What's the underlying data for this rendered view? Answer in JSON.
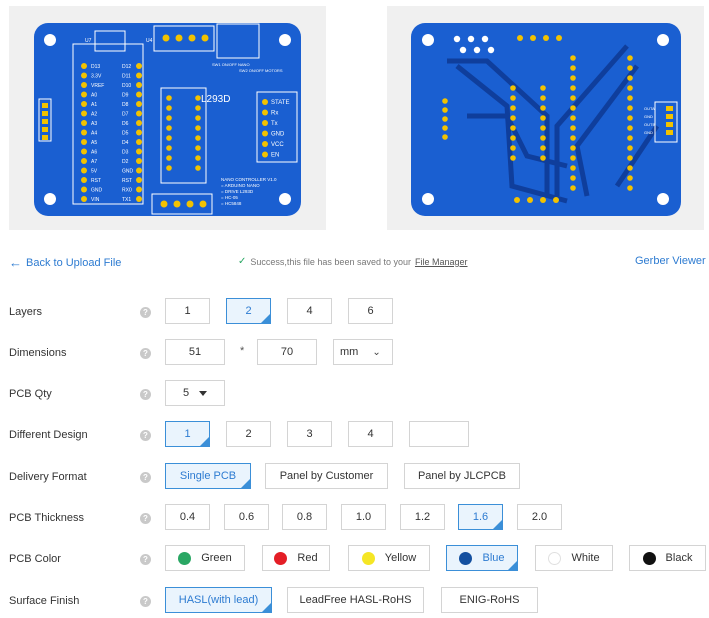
{
  "preview": {
    "front": {
      "module_labels": [
        "U7",
        "U4"
      ],
      "header_pins_left": [
        "D13",
        "3.3V",
        "VREF",
        "A0",
        "A1",
        "A2",
        "A3",
        "A4",
        "A5",
        "A6",
        "A7",
        "5V",
        "RST",
        "GND",
        "VIN"
      ],
      "header_pins_right": [
        "D12",
        "D11",
        "D10",
        "D9",
        "D8",
        "D7",
        "D6",
        "D5",
        "D4",
        "D3",
        "D2",
        "GND",
        "RST",
        "RX0",
        "TX1"
      ],
      "ic_label": "L293D",
      "bt_pins": [
        "STATE",
        "Rx",
        "Tx",
        "GND",
        "VCC",
        "EN"
      ],
      "switch_labels": [
        "SW1 ON/OFF NANO",
        "SW2 ON/OFF MOTORS"
      ],
      "info_lines": [
        "NANO CONTROLLER V1.0",
        "= ARDUINO NANO",
        "= DRIVE L293D",
        "= HC-05",
        "= HC5848"
      ]
    },
    "back": {
      "side_labels": [
        "OUTA",
        "GND",
        "OUTB",
        "GND"
      ]
    }
  },
  "nav": {
    "back_label": "Back to Upload File",
    "success_text": "Success,this file has been saved to your",
    "file_manager_label": "File Manager",
    "gerber_label": "Gerber Viewer"
  },
  "form": {
    "layers": {
      "label": "Layers",
      "options": [
        "1",
        "2",
        "4",
        "6"
      ],
      "selected": "2"
    },
    "dimensions": {
      "label": "Dimensions",
      "width": "51",
      "height": "70",
      "separator": "*",
      "unit": "mm"
    },
    "qty": {
      "label": "PCB Qty",
      "value": "5"
    },
    "different_design": {
      "label": "Different Design",
      "options": [
        "1",
        "2",
        "3",
        "4"
      ],
      "selected": "1",
      "custom": ""
    },
    "delivery": {
      "label": "Delivery Format",
      "options": [
        "Single PCB",
        "Panel by Customer",
        "Panel by JLCPCB"
      ],
      "selected": "Single PCB"
    },
    "thickness": {
      "label": "PCB Thickness",
      "options": [
        "0.4",
        "0.6",
        "0.8",
        "1.0",
        "1.2",
        "1.6",
        "2.0"
      ],
      "selected": "1.6"
    },
    "color": {
      "label": "PCB Color",
      "options": [
        {
          "name": "Green",
          "hex": "#2aa764"
        },
        {
          "name": "Red",
          "hex": "#e41e26"
        },
        {
          "name": "Yellow",
          "hex": "#f5e625"
        },
        {
          "name": "Blue",
          "hex": "#1450a0"
        },
        {
          "name": "White",
          "hex": "#ffffff"
        },
        {
          "name": "Black",
          "hex": "#111111"
        }
      ],
      "selected": "Blue"
    },
    "finish": {
      "label": "Surface Finish",
      "options": [
        "HASL(with lead)",
        "LeadFree HASL-RoHS",
        "ENIG-RoHS"
      ],
      "selected": "HASL(with lead)"
    }
  },
  "colors": {
    "accent": "#2d7bd1",
    "selected_bg": "#eaf4fd",
    "pcb_blue": "#1a5fd1"
  }
}
